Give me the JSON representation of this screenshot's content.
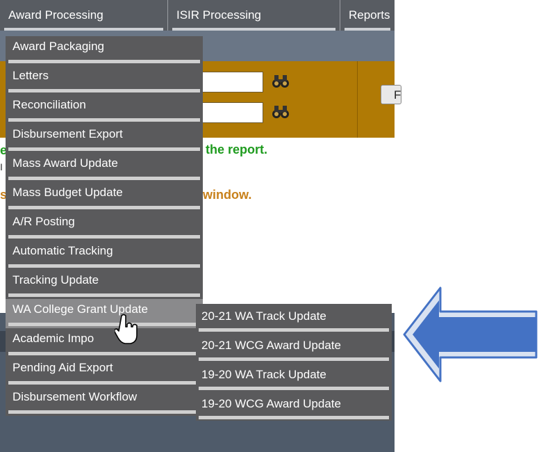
{
  "top_menu": [
    {
      "label": "Award Processing"
    },
    {
      "label": "ISIR Processing"
    },
    {
      "label": "Reports"
    }
  ],
  "background": {
    "find_button_label": "F",
    "green_message": "the report.",
    "orange_message": "window.",
    "fragment_left_green": "e",
    "fragment_left_orange": "s",
    "fragment_left_small": "I"
  },
  "dropdown": {
    "items": [
      {
        "label": "Award Packaging"
      },
      {
        "label": "Letters"
      },
      {
        "label": "Reconciliation"
      },
      {
        "label": "Disbursement Export"
      },
      {
        "label": "Mass Award Update"
      },
      {
        "label": "Mass Budget Update"
      },
      {
        "label": "A/R Posting"
      },
      {
        "label": "Automatic Tracking"
      },
      {
        "label": "Tracking Update"
      },
      {
        "label": "WA College Grant Update"
      },
      {
        "label": "Academic Impo"
      },
      {
        "label": "Pending Aid Export"
      },
      {
        "label": "Disbursement Workflow"
      }
    ]
  },
  "submenu": {
    "items": [
      {
        "label": "20-21 WA Track Update"
      },
      {
        "label": "20-21 WCG Award Update"
      },
      {
        "label": "19-20 WA Track Update"
      },
      {
        "label": "19-20 WCG Award Update"
      }
    ]
  },
  "colors": {
    "menu_bg": "#5a5a5c",
    "active_item_bg": "#8a8a8c",
    "orange_panel": "#b07a05",
    "arrow_fill": "#4472c4"
  },
  "icons": {
    "binoculars": "binoculars-icon",
    "cursor": "hand-pointer-icon",
    "callout": "left-arrow-callout"
  }
}
